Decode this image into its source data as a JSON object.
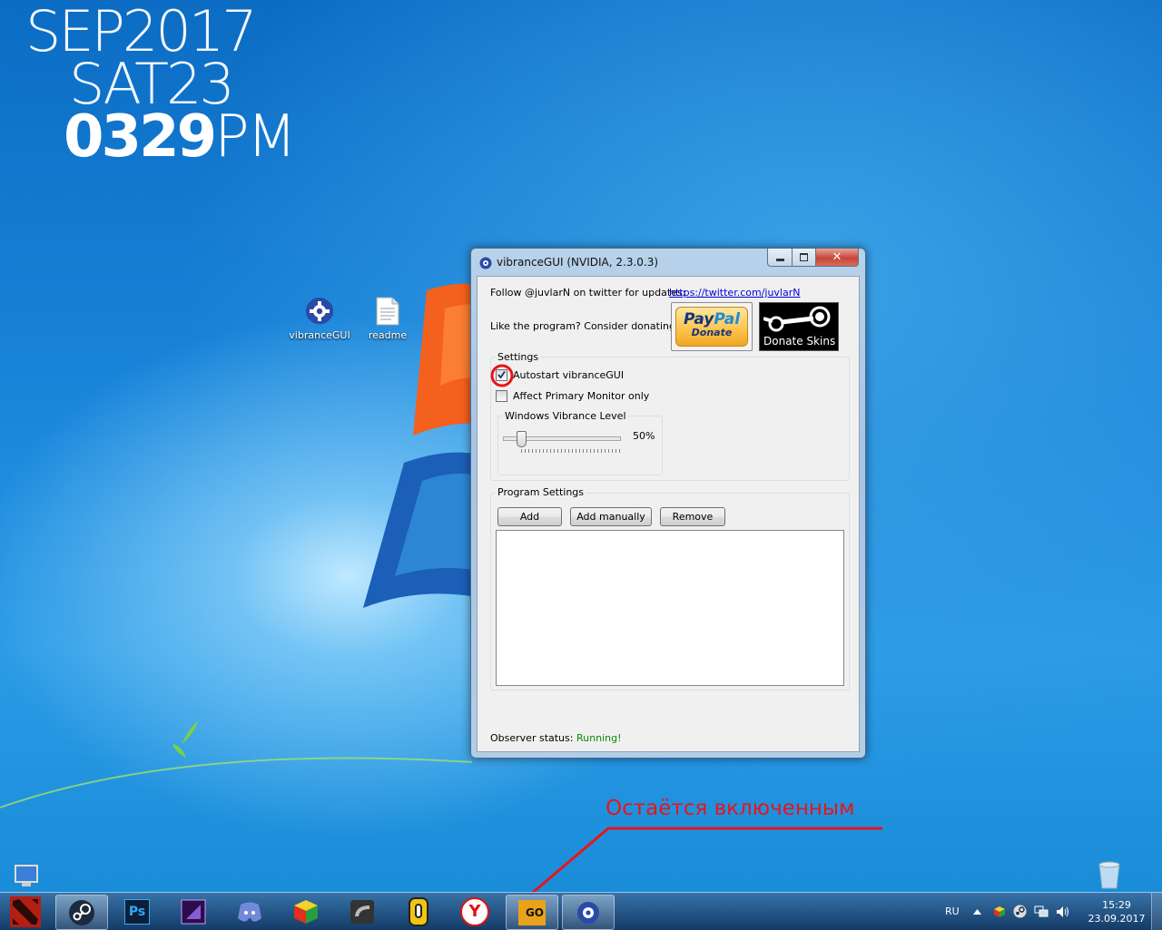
{
  "desktop": {
    "clock": {
      "line1": "SEP2017",
      "line2": "SAT23",
      "time": "0329",
      "ampm": "PM"
    },
    "icons": [
      {
        "label": "vibranceGUI",
        "icon": "gear-icon"
      },
      {
        "label": "readme",
        "icon": "text-file-icon"
      }
    ],
    "annotation": "Остаётся включенным"
  },
  "window": {
    "title": "vibranceGUI (NVIDIA, 2.3.0.3)",
    "close_glyph": "✕",
    "follow_text": "Follow @juvlarN on twitter for updates:",
    "twitter_link": "https://twitter.com/juvlarN",
    "donate_text": "Like the program? Consider donating:",
    "paypal": {
      "word1": "Pay",
      "word2": "Pal",
      "sub": "Donate"
    },
    "steam_label": "Donate Skins",
    "settings": {
      "title": "Settings",
      "autostart_label": "Autostart vibranceGUI",
      "autostart_checked": true,
      "affect_label": "Affect Primary Monitor only",
      "affect_checked": false,
      "vibrance_title": "Windows Vibrance Level",
      "vibrance_value_text": "50%",
      "vibrance_value": 50
    },
    "program_settings": {
      "title": "Program Settings",
      "add_label": "Add",
      "add_manually_label": "Add manually",
      "remove_label": "Remove",
      "items": []
    },
    "status_label": "Observer status:",
    "status_value": "Running!"
  },
  "taskbar": {
    "apps": [
      "dota2-icon",
      "steam-icon",
      "photoshop-icon",
      "premiere-icon",
      "discord-icon",
      "rubiks-cube-icon",
      "nvidia-icon",
      "keyboard-icon",
      "yandex-browser-icon",
      "csgo-icon",
      "vibrancegui-icon"
    ],
    "ps_text": "Ps",
    "csgo_text": "GO",
    "yandex_text": "Y",
    "lang": "RU",
    "time": "15:29",
    "date": "23.09.2017"
  },
  "colors": {
    "accent_red": "#e8141c",
    "status_green": "#0a8a0a",
    "link_blue": "#0000e0"
  }
}
